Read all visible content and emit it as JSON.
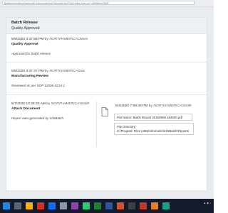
{
  "browser": {
    "address": "BigBatchWorkflowSystem/BLS/ApprovalView?recordId=bc7f74c2-9d6a-1aac-a17-63935b3a7fe09"
  },
  "header": {
    "title": "Batch Release",
    "status": "Quality Approved"
  },
  "entries": [
    {
      "timestamp": "5/9/2020 3:27:55 PM",
      "by": "by",
      "user": "NORTHAMERICA\\Jones",
      "action": "Quality Approve",
      "note": "Approved for batch release"
    },
    {
      "timestamp": "5/8/2020 3:27:47 PM",
      "by": "by",
      "user": "NORTHAMERICA\\Doe",
      "action": "Manufacturing Review",
      "note": "Reviewed as per SOP 12006-0214-1"
    },
    {
      "timestamp": "5/7/2020 10:25:33 AM",
      "by": "by",
      "user": "NORTHAMERICA\\Smith",
      "action": "Attach Document",
      "note": "Report auto-generated by InfoBatch"
    }
  ],
  "attachment": {
    "timestamp": "5/4/2020 7:59:49 PM",
    "by": "by",
    "user": "NORTHAMERICA\\Smith",
    "file_label": "File Name:",
    "file_name": "Batch Report 20190908.184500.pdf",
    "dir_label": "File Directory:",
    "dir_path": "C:\\Program Files (x86)\\Informetic\\InfoBatch\\Reports",
    "icon": "document-icon"
  },
  "taskbar": {
    "icons": [
      {
        "name": "start-icon",
        "color": "#1e88e5"
      },
      {
        "name": "search-taskbar-icon",
        "color": "#5b6475"
      },
      {
        "name": "file-explorer-icon",
        "color": "#f4b400"
      },
      {
        "name": "chrome-icon",
        "color": "#d93025"
      },
      {
        "name": "mail-icon",
        "color": "#0d6efd"
      },
      {
        "name": "settings-icon",
        "color": "#8e99a8"
      },
      {
        "name": "visual-studio-icon",
        "color": "#8e44ad"
      },
      {
        "name": "store-icon",
        "color": "#2ecc71"
      },
      {
        "name": "excel-icon",
        "color": "#1e7e34"
      },
      {
        "name": "word-icon",
        "color": "#2b579a"
      },
      {
        "name": "powerpoint-icon",
        "color": "#d35230"
      },
      {
        "name": "terminal-icon",
        "color": "#3c4043"
      },
      {
        "name": "app-icon",
        "color": "#c0392b"
      },
      {
        "name": "app-icon-2",
        "color": "#e67e22"
      },
      {
        "name": "app-icon-3",
        "color": "#16a085"
      }
    ]
  }
}
